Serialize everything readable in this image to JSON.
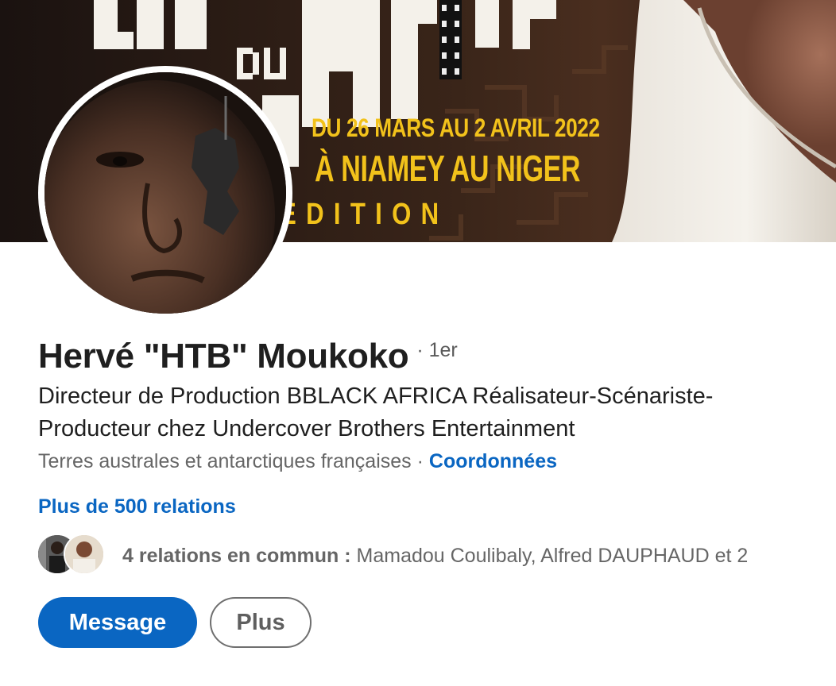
{
  "banner": {
    "line1": "DU 26 MARS AU 2 AVRIL 2022",
    "line2": "À NIAMEY AU NIGER",
    "line3": "EDITION",
    "accent_color": "#f2c21b"
  },
  "profile": {
    "name": "Hervé \"HTB\" Moukoko",
    "degree": "· 1er",
    "headline": "Directeur de Production BBLACK AFRICA Réalisateur-Scénariste-Producteur chez Undercover Brothers Entertainment",
    "location": "Terres australes et antarctiques françaises",
    "separator": " · ",
    "contact_link": "Coordonnées",
    "connections": "Plus de 500 relations"
  },
  "mutual": {
    "count_label": "4 relations en commun :",
    "names": " Mamadou Coulibaly, Alfred DAUPHAUD et 2"
  },
  "actions": {
    "message_label": "Message",
    "more_label": "Plus"
  },
  "colors": {
    "link": "#0a66c2",
    "primary_button": "#0a66c2",
    "text_primary": "#1f1f1f",
    "text_secondary": "#666666"
  }
}
